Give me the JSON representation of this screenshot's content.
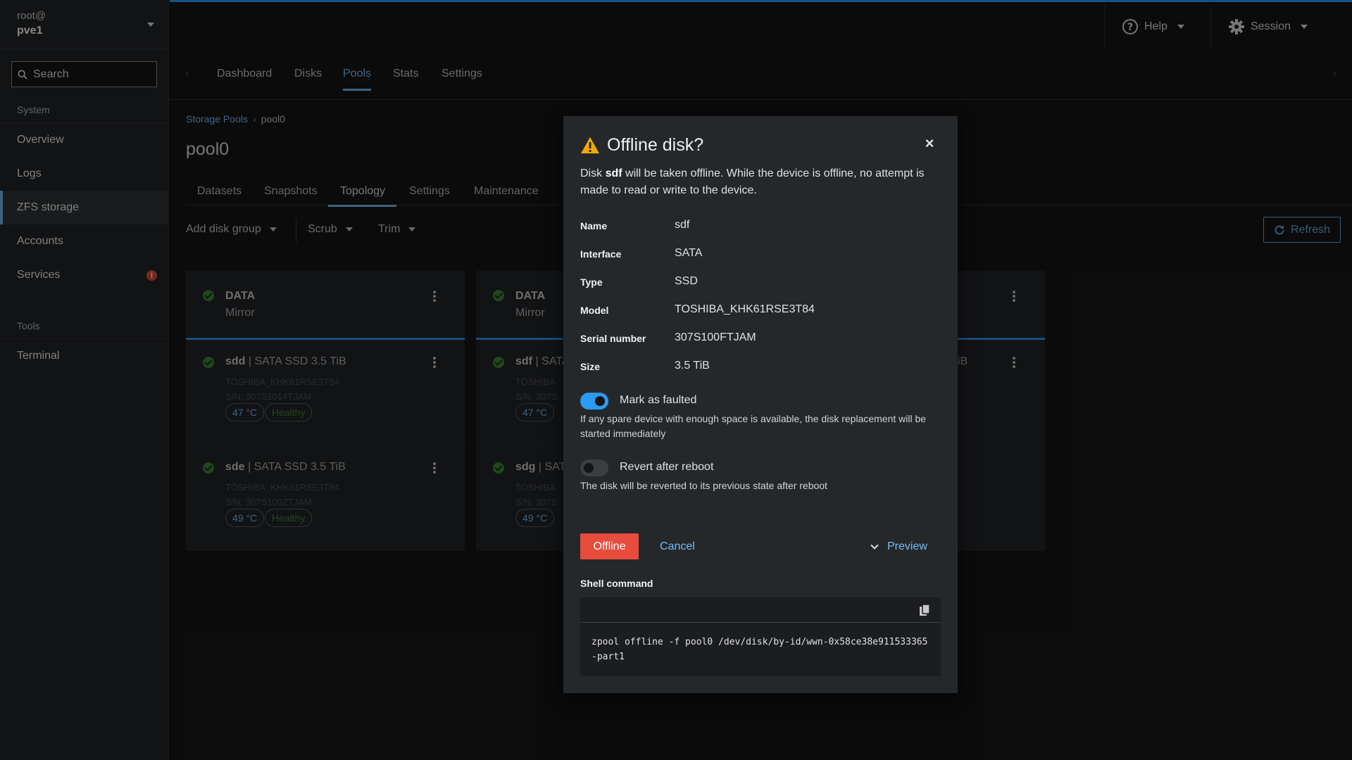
{
  "host": {
    "user": "root@",
    "name": "pve1"
  },
  "search": {
    "placeholder": "Search"
  },
  "sidebar": {
    "system_label": "System",
    "items": [
      {
        "label": "Overview"
      },
      {
        "label": "Logs"
      },
      {
        "label": "ZFS storage"
      },
      {
        "label": "Accounts"
      },
      {
        "label": "Services",
        "badge": "!"
      }
    ],
    "tools_label": "Tools",
    "tools_items": [
      {
        "label": "Terminal"
      }
    ]
  },
  "topbar": {
    "help_label": "Help",
    "session_label": "Session"
  },
  "main_tabs": [
    "Dashboard",
    "Disks",
    "Pools",
    "Stats",
    "Settings"
  ],
  "breadcrumb": {
    "parent": "Storage Pools",
    "current": "pool0"
  },
  "page_title": "pool0",
  "sub_tabs": [
    "Datasets",
    "Snapshots",
    "Topology",
    "Settings",
    "Maintenance"
  ],
  "toolbar": {
    "add_disk_group": "Add disk group",
    "scrub": "Scrub",
    "trim": "Trim",
    "refresh": "Refresh"
  },
  "cards": [
    {
      "type": "DATA",
      "layout": "Mirror",
      "disks": [
        {
          "name": "sdd",
          "desc": " | SATA SSD 3.5 TiB",
          "model": "TOSHIBA_KHK61RSE3T84",
          "serial": "S/N: 307S1014TJAM",
          "temp": "47 °C",
          "health": "Healthy"
        },
        {
          "name": "sde",
          "desc": " | SATA SSD 3.5 TiB",
          "model": "TOSHIBA_KHK61RSE3T84",
          "serial": "S/N: 307S100ZTJAM",
          "temp": "49 °C",
          "health": "Healthy"
        }
      ]
    },
    {
      "type": "DATA",
      "layout": "Mirror",
      "disks": [
        {
          "name": "sdf",
          "desc": " | SATA",
          "model": "TOSHIBA",
          "serial": "S/N: 307S",
          "temp": "47 °C"
        },
        {
          "name": "sdg",
          "desc": " | SATA",
          "model": "TOSHIBA",
          "serial": "S/N: 307S",
          "temp": "49 °C"
        }
      ]
    }
  ],
  "right_fragment_text": "iB",
  "modal": {
    "title": "Offline disk?",
    "desc_prefix": "Disk ",
    "desc_disk": "sdf",
    "desc_suffix": " will be taken offline. While the device is offline, no attempt is made to read or write to the device.",
    "props": [
      {
        "label": "Name",
        "value": "sdf"
      },
      {
        "label": "Interface",
        "value": "SATA"
      },
      {
        "label": "Type",
        "value": "SSD"
      },
      {
        "label": "Model",
        "value": "TOSHIBA_KHK61RSE3T84"
      },
      {
        "label": "Serial number",
        "value": "307S100FTJAM"
      },
      {
        "label": "Size",
        "value": "3.5 TiB"
      }
    ],
    "mark_faulted": {
      "label": "Mark as faulted",
      "checked": true,
      "help": "If any spare device with enough space is available, the disk replacement will be started immediately"
    },
    "revert_reboot": {
      "label": "Revert after reboot",
      "checked": false,
      "help": "The disk will be reverted to its previous state after reboot"
    },
    "offline_label": "Offline",
    "cancel_label": "Cancel",
    "preview_label": "Preview",
    "shell_label": "Shell command",
    "shell_command": "zpool offline -f pool0 /dev/disk/by-id/wwn-0x58ce38e911533365-part1"
  },
  "colors": {
    "accent": "#73bcf7",
    "primary": "#2b9af3",
    "danger": "#e74c3c",
    "success": "#3e8635",
    "warning": "#f0ab00"
  }
}
